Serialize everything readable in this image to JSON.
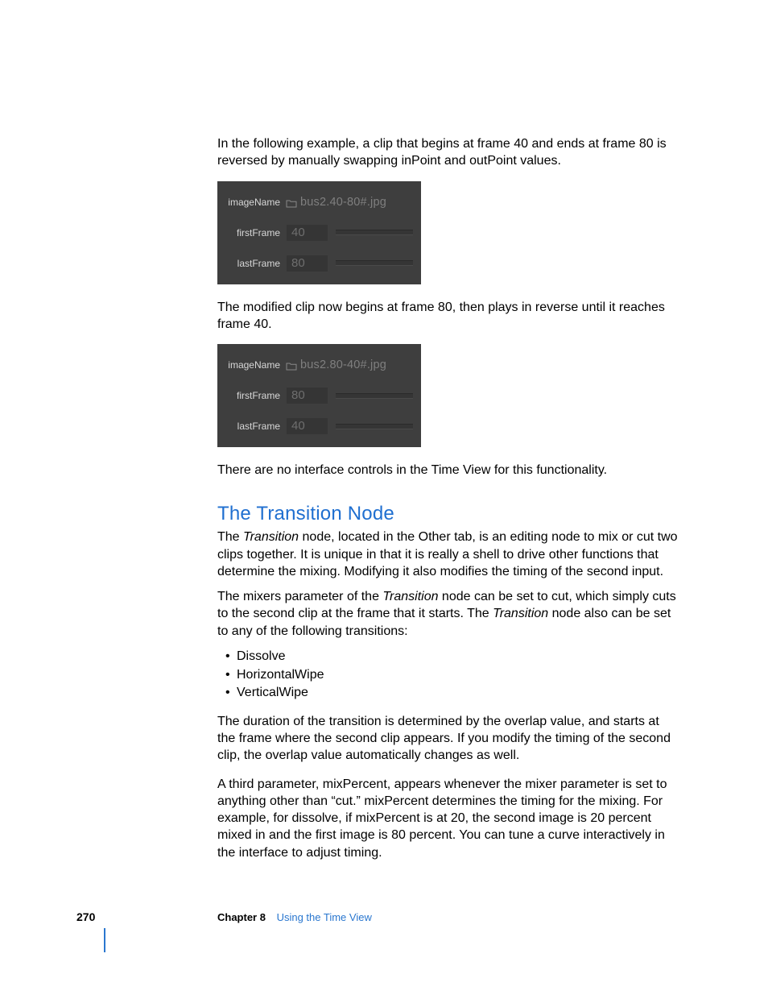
{
  "content": {
    "p1": "In the following example, a clip that begins at frame 40 and ends at frame 80 is reversed by manually swapping inPoint and outPoint values.",
    "panel1": {
      "imageNameLabel": "imageName",
      "imageNameValue": "bus2.40-80#.jpg",
      "firstFrameLabel": "firstFrame",
      "firstFrameValue": "40",
      "lastFrameLabel": "lastFrame",
      "lastFrameValue": "80"
    },
    "p2": "The modified clip now begins at frame 80, then plays in reverse until it reaches frame 40.",
    "panel2": {
      "imageNameLabel": "imageName",
      "imageNameValue": "bus2.80-40#.jpg",
      "firstFrameLabel": "firstFrame",
      "firstFrameValue": "80",
      "lastFrameLabel": "lastFrame",
      "lastFrameValue": "40"
    },
    "p3": "There are no interface controls in the Time View for this functionality.",
    "h1": "The Transition Node",
    "p4a": "The ",
    "p4b": "Transition",
    "p4c": " node, located in the Other tab, is an editing node to mix or cut two clips together. It is unique in that it is really a shell to drive other functions that determine the mixing. Modifying it also modifies the timing of the second input.",
    "p5a": "The mixers parameter of the ",
    "p5b": "Transition",
    "p5c": " node can be set to cut, which simply cuts to the second clip at the frame that it starts. The ",
    "p5d": "Transition",
    "p5e": " node also can be set to any of the following transitions:",
    "bullets": {
      "b1": "Dissolve",
      "b2": "HorizontalWipe",
      "b3": "VerticalWipe"
    },
    "p6": "The duration of the transition is determined by the overlap value, and starts at the frame where the second clip appears. If you modify the timing of the second clip, the overlap value automatically changes as well.",
    "p7": "A third parameter, mixPercent, appears whenever the mixer parameter is set to anything other than “cut.” mixPercent determines the timing for the mixing. For example, for dissolve, if mixPercent is at 20, the second image is 20 percent mixed in and the first image is 80 percent. You can tune a curve interactively in the interface to adjust timing."
  },
  "footer": {
    "page": "270",
    "chapterLabel": "Chapter 8",
    "chapterTitle": "Using the Time View"
  }
}
